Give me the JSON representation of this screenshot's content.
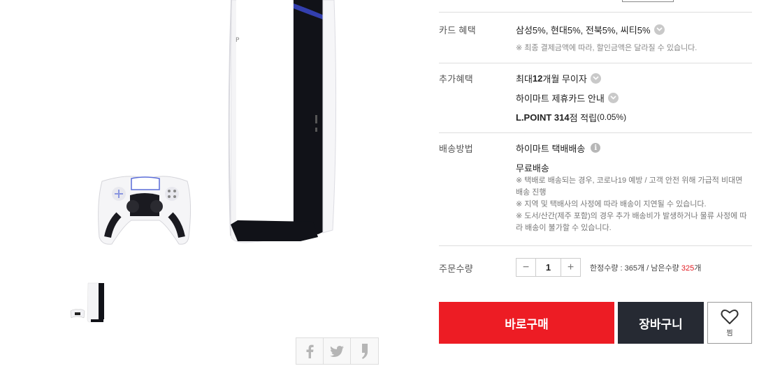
{
  "card_benefit": {
    "label": "카드 혜택",
    "value": "삼성5%, 현대5%, 전북5%, 씨티5%",
    "note": "※ 최종 결제금액에 따라, 할인금액은 달라질 수 있습니다."
  },
  "extra_benefit": {
    "label": "추가혜택",
    "installment_prefix": "최대 ",
    "installment_bold": "12",
    "installment_suffix": "개월 무이자",
    "partner_card": "하이마트 제휴카드 안내",
    "lpoint_bold": "L.POINT 314",
    "lpoint_mid": " 점 적립 ",
    "lpoint_rate": "(0.05%)"
  },
  "shipping": {
    "label": "배송방법",
    "method": "하이마트 택배배송",
    "info_icon": "i",
    "fee": "무료배송",
    "notes": [
      "※ 택배로 배송되는 경우, 코로나19 예방 / 고객 안전 위해 가급적 비대면 배송 진행",
      "※ 지역 및 택배사의 사정에 따라 배송이 지연될 수 있습니다.",
      "※ 도서/산간(제주 포함)의 경우 추가 배송비가 발생하거나 물류 사정에 따라 배송이 불가할 수 있습니다."
    ]
  },
  "order": {
    "label": "주문수량",
    "quantity": "1",
    "minus": "−",
    "plus": "+",
    "limit_text": "한정수량 : 365개 / 남은수량 ",
    "remaining": "325",
    "unit": "개"
  },
  "actions": {
    "buy": "바로구매",
    "cart": "장바구니",
    "wish": "찜"
  },
  "icons": {
    "share_facebook": "facebook-icon",
    "share_twitter": "twitter-icon",
    "share_other": "share-icon",
    "wish": "heart-icon"
  }
}
